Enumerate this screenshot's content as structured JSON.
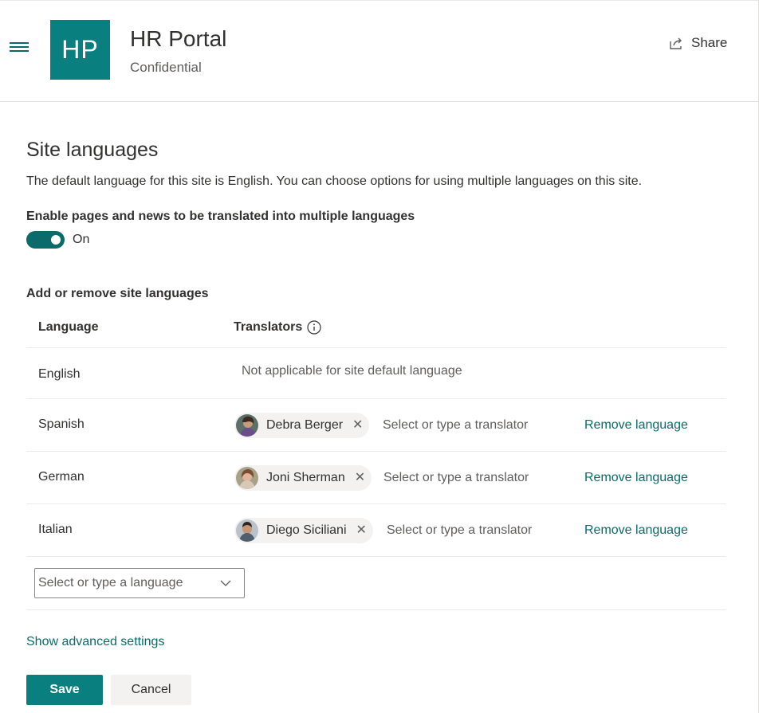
{
  "header": {
    "logo_text": "HP",
    "site_title": "HR Portal",
    "site_subtitle": "Confidential",
    "share_label": "Share",
    "menu_icon": "hamburger-icon",
    "share_icon": "share-icon",
    "brand_color": "#097f80"
  },
  "page": {
    "title": "Site languages",
    "description": "The default language for this site is English. You can choose options for using multiple languages on this site.",
    "toggle_label": "Enable pages and news to be translated into multiple languages",
    "toggle_state": "On",
    "toggle_on": true,
    "section_label": "Add or remove site languages"
  },
  "table": {
    "col_language": "Language",
    "col_translators": "Translators",
    "info_icon": "info-icon",
    "default_row": {
      "language": "English",
      "note": "Not applicable for site default language"
    },
    "rows": [
      {
        "language": "Spanish",
        "translator": "Debra Berger",
        "placeholder": "Select or type a translator",
        "remove_label": "Remove language"
      },
      {
        "language": "German",
        "translator": "Joni Sherman",
        "placeholder": "Select or type a translator",
        "remove_label": "Remove language"
      },
      {
        "language": "Italian",
        "translator": "Diego Siciliani",
        "placeholder": "Select or type a translator",
        "remove_label": "Remove language"
      }
    ]
  },
  "add_language": {
    "placeholder": "Select or type a language",
    "chevron_icon": "chevron-down-icon"
  },
  "advanced_link": "Show advanced settings",
  "buttons": {
    "save": "Save",
    "cancel": "Cancel"
  }
}
